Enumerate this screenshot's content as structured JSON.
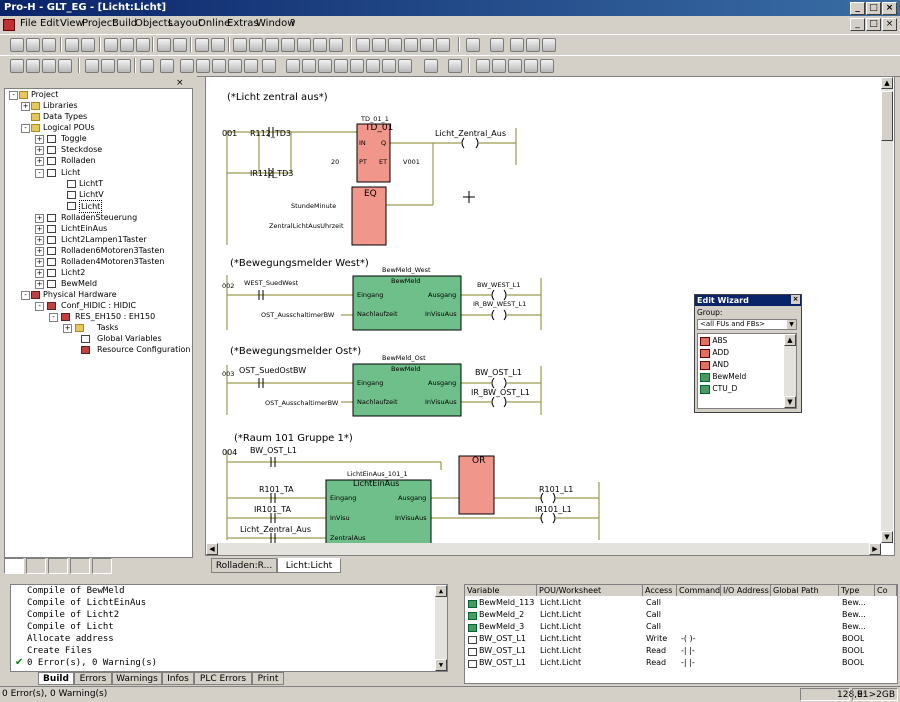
{
  "window": {
    "title": "Pro-H - GLT_EG - [Licht:Licht]",
    "buttons": [
      "_",
      "□",
      "×"
    ],
    "child_buttons": [
      "_",
      "□",
      "×"
    ]
  },
  "menu": [
    "File",
    "Edit",
    "View",
    "Project",
    "Build",
    "Objects",
    "Layout",
    "Online",
    "Extras",
    "Window",
    "?"
  ],
  "tree": {
    "project": "Project",
    "libraries": "Libraries",
    "data_types": "Data Types",
    "logical_pous": "Logical POUs",
    "pous": [
      "Toggle",
      "Steckdose",
      "Rolladen"
    ],
    "licht": "Licht",
    "licht_children": [
      "LichtT",
      "LichtV",
      "Licht"
    ],
    "pous2": [
      "RolladenSteuerung",
      "LichtEinAus",
      "Licht2Lampen1Taster",
      "Rolladen6Motoren3Tasten",
      "Rolladen4Motoren3Tasten",
      "Licht2",
      "BewMeld"
    ],
    "physical_hardware": "Physical Hardware",
    "conf": "Conf_HIDIC : HIDIC",
    "res": "RES_EH150 : EH150",
    "res_children": [
      "Tasks",
      "Global Variables",
      "Resource Configuration"
    ]
  },
  "editor_tabs": [
    "Rolladen:R...",
    "Licht:Licht"
  ],
  "diagram": {
    "net1": {
      "comment": "(*Licht zentral aus*)",
      "label": "001",
      "contact1": "R112_TD3",
      "contact2": "IR112_TD3",
      "timer_instance": "TD_01_1",
      "timer_name": "TD_01",
      "timer_in": "IN",
      "timer_pt": "PT",
      "timer_q": "Q",
      "timer_et": "ET",
      "pt_value": "20",
      "et_var": "V001",
      "coil": "Licht_Zentral_Aus",
      "eq_name": "EQ",
      "eq_in1": "StundeMinute",
      "eq_in2": "ZentralLichtAusUhrzeit"
    },
    "net2": {
      "comment": "(*Bewegungsmelder West*)",
      "label": "002",
      "instance": "BewMeld_West",
      "type": "BewMeld",
      "in1": "Eingang",
      "in2": "Nachlaufzeit",
      "out1": "Ausgang",
      "out2": "InVisuAus",
      "contact": "WEST_SuedWest",
      "in2_var": "OST_AusschaltimerBW",
      "coil1": "BW_WEST_L1",
      "coil2": "IR_BW_WEST_L1"
    },
    "net3": {
      "comment": "(*Bewegungsmelder Ost*)",
      "label": "003",
      "instance": "BewMeld_Ost",
      "type": "BewMeld",
      "in1": "Eingang",
      "in2": "Nachlaufzeit",
      "out1": "Ausgang",
      "out2": "InVisuAus",
      "contact": "OST_SuedOstBW",
      "in2_var": "OST_AusschaltimerBW",
      "coil1": "BW_OST_L1",
      "coil2": "IR_BW_OST_L1"
    },
    "net4": {
      "comment": "(*Raum 101 Gruppe 1*)",
      "label": "004",
      "contact_top": "BW_OST_L1",
      "instance": "LichtEinAus_101_1",
      "type": "LichtEinAus",
      "in1": "Eingang",
      "in2": "InVisu",
      "in3": "ZentralAus",
      "out1": "Ausgang",
      "out2": "InVisuAus",
      "contact1": "R101_TA",
      "contact2": "IR101_TA",
      "contact3": "Licht_Zentral_Aus",
      "or_name": "OR",
      "coil1": "R101_L1",
      "coil2": "IR101_L1"
    }
  },
  "edit_wizard": {
    "title": "Edit Wizard",
    "group_label": "Group:",
    "group_value": "<all FUs and FBs>",
    "items": [
      "ABS",
      "ADD",
      "AND",
      "BewMeld",
      "CTU_D"
    ]
  },
  "messages": {
    "lines": [
      "Compile of BewMeld",
      "Compile of LichtEinAus",
      "Compile of Licht2",
      "Compile of Licht",
      "Allocate address",
      "Create Files",
      "0 Error(s), 0 Warning(s)"
    ],
    "tabs": [
      "Build",
      "Errors",
      "Warnings",
      "Infos",
      "PLC Errors",
      "Print"
    ]
  },
  "xref": {
    "headers": [
      "Variable",
      "POU/Worksheet",
      "Access",
      "Command",
      "I/O Address",
      "Global Path",
      "Type",
      "Co"
    ],
    "rows": [
      [
        "BewMeld_113",
        "Licht.Licht",
        "Call",
        "",
        "",
        "",
        "Bew..."
      ],
      [
        "BewMeld_2",
        "Licht.Licht",
        "Call",
        "",
        "",
        "",
        "Bew..."
      ],
      [
        "BewMeld_3",
        "Licht.Licht",
        "Call",
        "",
        "",
        "",
        "Bew..."
      ],
      [
        "BW_OST_L1",
        "Licht.Licht",
        "Write",
        "-( )-",
        "",
        "",
        "BOOL"
      ],
      [
        "BW_OST_L1",
        "Licht.Licht",
        "Read",
        "-| |-",
        "",
        "",
        "BOOL"
      ],
      [
        "BW_OST_L1",
        "Licht.Licht",
        "Read",
        "-| |-",
        "",
        "",
        "BOOL"
      ]
    ]
  },
  "status": {
    "left": "0 Error(s), 0 Warning(s)",
    "position": "128,91",
    "disk": "E: >2GB"
  },
  "colors": {
    "title_bar": "#0a246a",
    "timer_block": "#f0968a",
    "fb_block": "#6fbf8a",
    "power_rail": "#9a9a50"
  }
}
